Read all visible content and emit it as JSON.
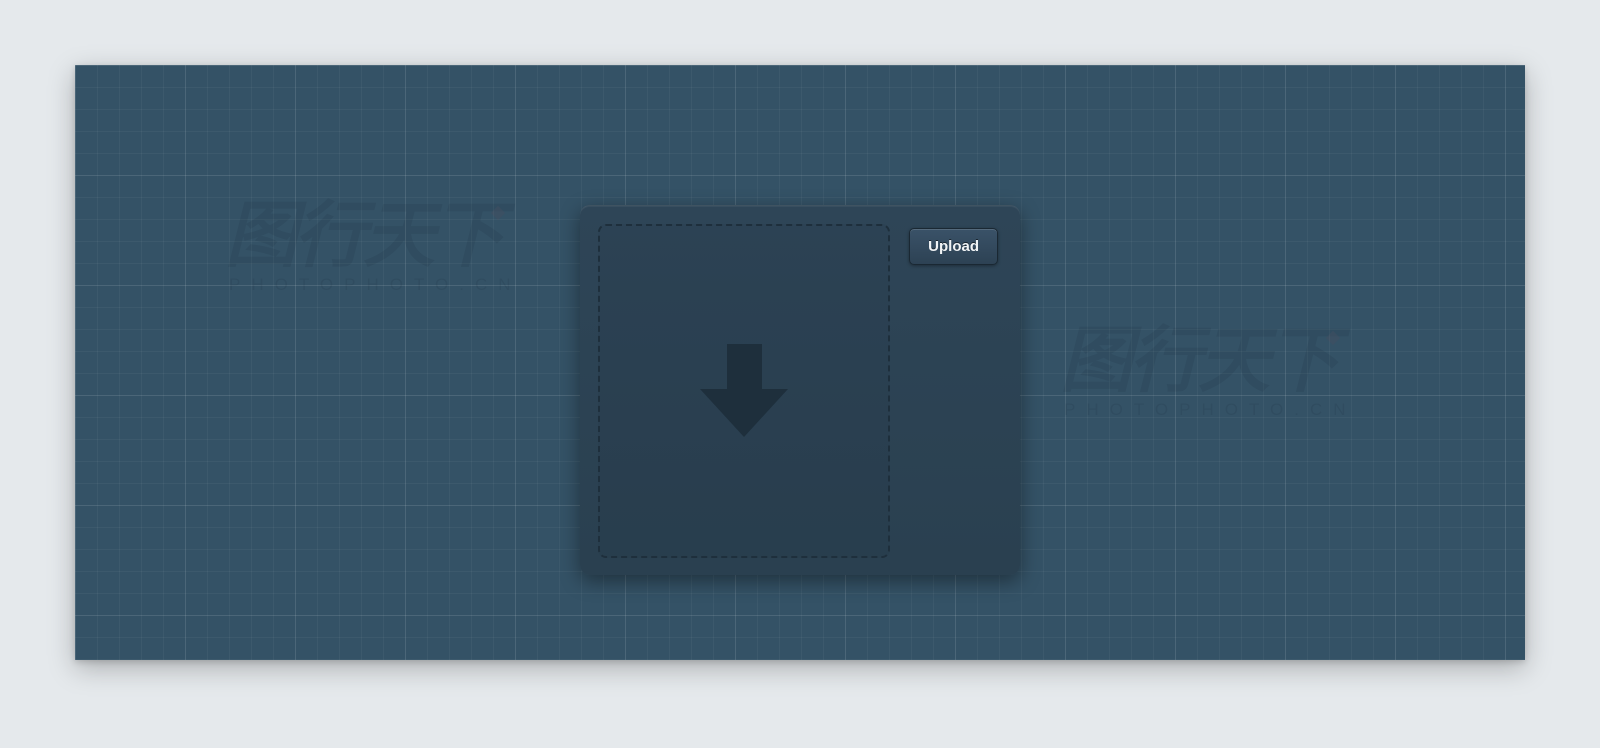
{
  "panel": {
    "upload_button_label": "Upload"
  },
  "watermark": {
    "logo_text": "图行天下",
    "url_text": "PHOTOPHOTO.CN"
  },
  "colors": {
    "page_bg": "#e5e9ec",
    "canvas_bg": "#345266",
    "panel_bg": "#2a4050",
    "dash_border": "#1e2f3c",
    "arrow": "#1e2f3c",
    "button_text": "#f0f3f5"
  }
}
